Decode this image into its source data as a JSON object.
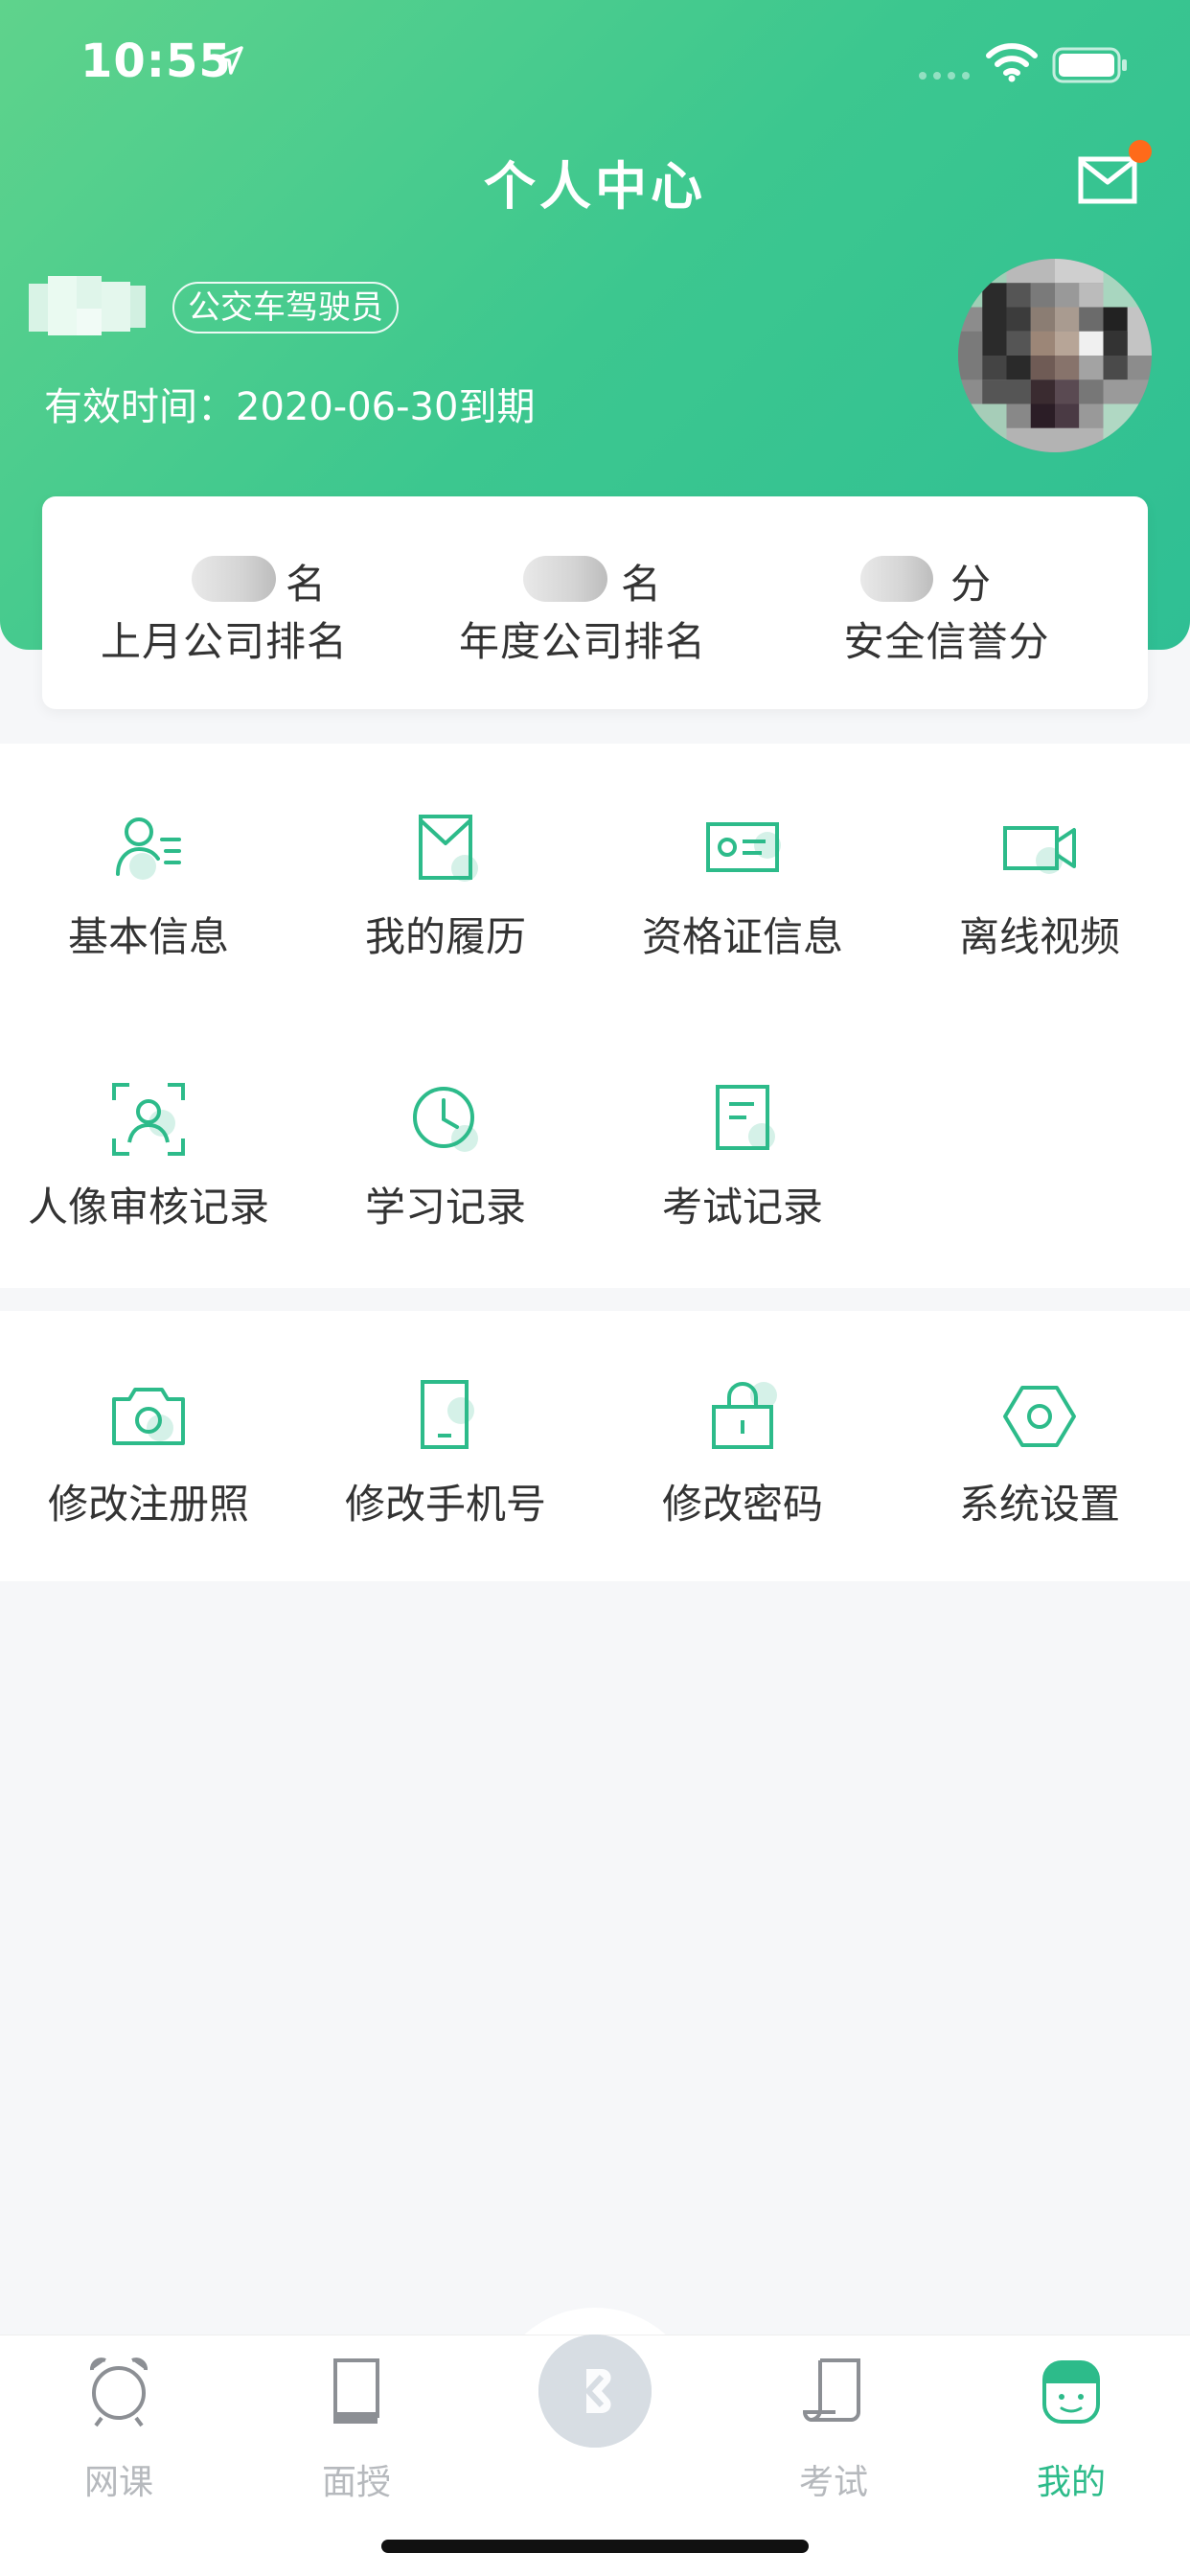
{
  "status_bar": {
    "time": "10:55"
  },
  "header": {
    "title": "个人中心",
    "role_badge": "公交车驾驶员",
    "valid_time": "有效时间：2020-06-30到期"
  },
  "ranks": [
    {
      "unit": "名",
      "label": "上月公司排名"
    },
    {
      "unit": "名",
      "label": "年度公司排名"
    },
    {
      "unit": "分",
      "label": "安全信誉分"
    }
  ],
  "menu1": [
    {
      "label": "基本信息",
      "icon": "person-info-icon"
    },
    {
      "label": "我的履历",
      "icon": "resume-icon"
    },
    {
      "label": "资格证信息",
      "icon": "certificate-icon"
    },
    {
      "label": "离线视频",
      "icon": "video-icon"
    },
    {
      "label": "人像审核记录",
      "icon": "face-scan-icon"
    },
    {
      "label": "学习记录",
      "icon": "clock-icon"
    },
    {
      "label": "考试记录",
      "icon": "exam-doc-icon"
    }
  ],
  "menu2": [
    {
      "label": "修改注册照",
      "icon": "camera-icon"
    },
    {
      "label": "修改手机号",
      "icon": "phone-icon"
    },
    {
      "label": "修改密码",
      "icon": "lock-icon"
    },
    {
      "label": "系统设置",
      "icon": "settings-icon"
    }
  ],
  "tabbar": [
    {
      "label": "网课",
      "icon": "alarm-clock-icon"
    },
    {
      "label": "面授",
      "icon": "book-icon"
    },
    {
      "label": "考试",
      "icon": "scroll-icon"
    },
    {
      "label": "我的",
      "icon": "profile-face-icon",
      "active": true
    }
  ],
  "colors": {
    "accent": "#2dbb8a",
    "header_start": "#5fd38c",
    "header_end": "#2fbf94",
    "notification_dot": "#ff6a1a"
  }
}
